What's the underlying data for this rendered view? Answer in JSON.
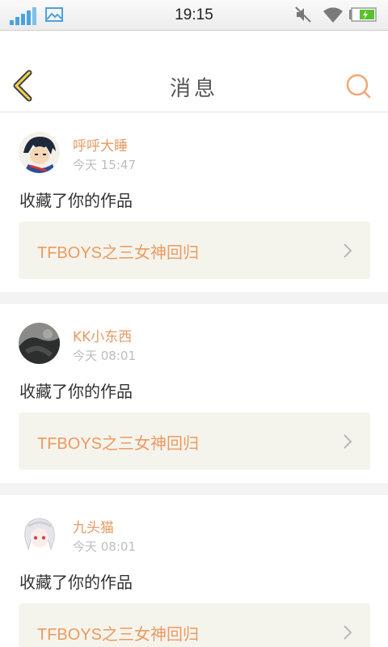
{
  "status_bar": {
    "time": "19:15",
    "icons": [
      "signal-icon",
      "image-icon",
      "mute-icon",
      "wifi-icon",
      "battery-charging-icon"
    ],
    "signal_color": "#4aa3e0",
    "battery_color": "#58c22c"
  },
  "nav": {
    "title": "消息",
    "back_icon": "back-chevron-icon",
    "search_icon": "search-icon",
    "accent": "#f1a774"
  },
  "messages": [
    {
      "user": "呼呼大睡",
      "time": "今天 15:47",
      "action": "收藏了你的作品",
      "work": "TFBOYS之三女神回归"
    },
    {
      "user": "KK小东西",
      "time": "今天 08:01",
      "action": "收藏了你的作品",
      "work": "TFBOYS之三女神回归"
    },
    {
      "user": "九头猫",
      "time": "今天 08:01",
      "action": "收藏了你的作品",
      "work": "TFBOYS之三女神回归"
    }
  ]
}
